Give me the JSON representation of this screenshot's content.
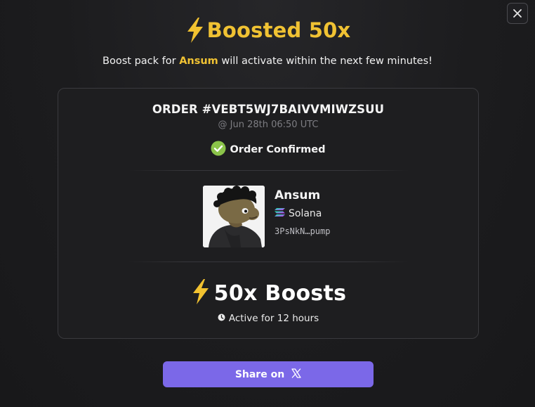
{
  "modal": {
    "title": "Boosted 50x",
    "subtitle_prefix": "Boost pack for ",
    "subtitle_token": "Ansum",
    "subtitle_suffix": " will activate within the next few minutes!"
  },
  "order": {
    "id_label": "ORDER #VEBT5WJ7BAIVVMIWZSUU",
    "timestamp": "@ Jun 28th 06:50 UTC",
    "status": "Order Confirmed"
  },
  "token": {
    "name": "Ansum",
    "chain": "Solana",
    "address": "3PsNkN…pump"
  },
  "boost": {
    "amount_label": "50x Boosts",
    "duration": "Active for 12 hours"
  },
  "actions": {
    "share_label": "Share on"
  },
  "colors": {
    "accent_gold": "#f0c233",
    "share_purple": "#7b68e8",
    "confirm_green": "#8bc34a"
  },
  "icons": {
    "close": "close-icon",
    "bolt": "lightning-bolt-icon",
    "check": "check-circle-icon",
    "chain": "solana-icon",
    "clock": "clock-icon",
    "share": "x-logo-icon"
  }
}
